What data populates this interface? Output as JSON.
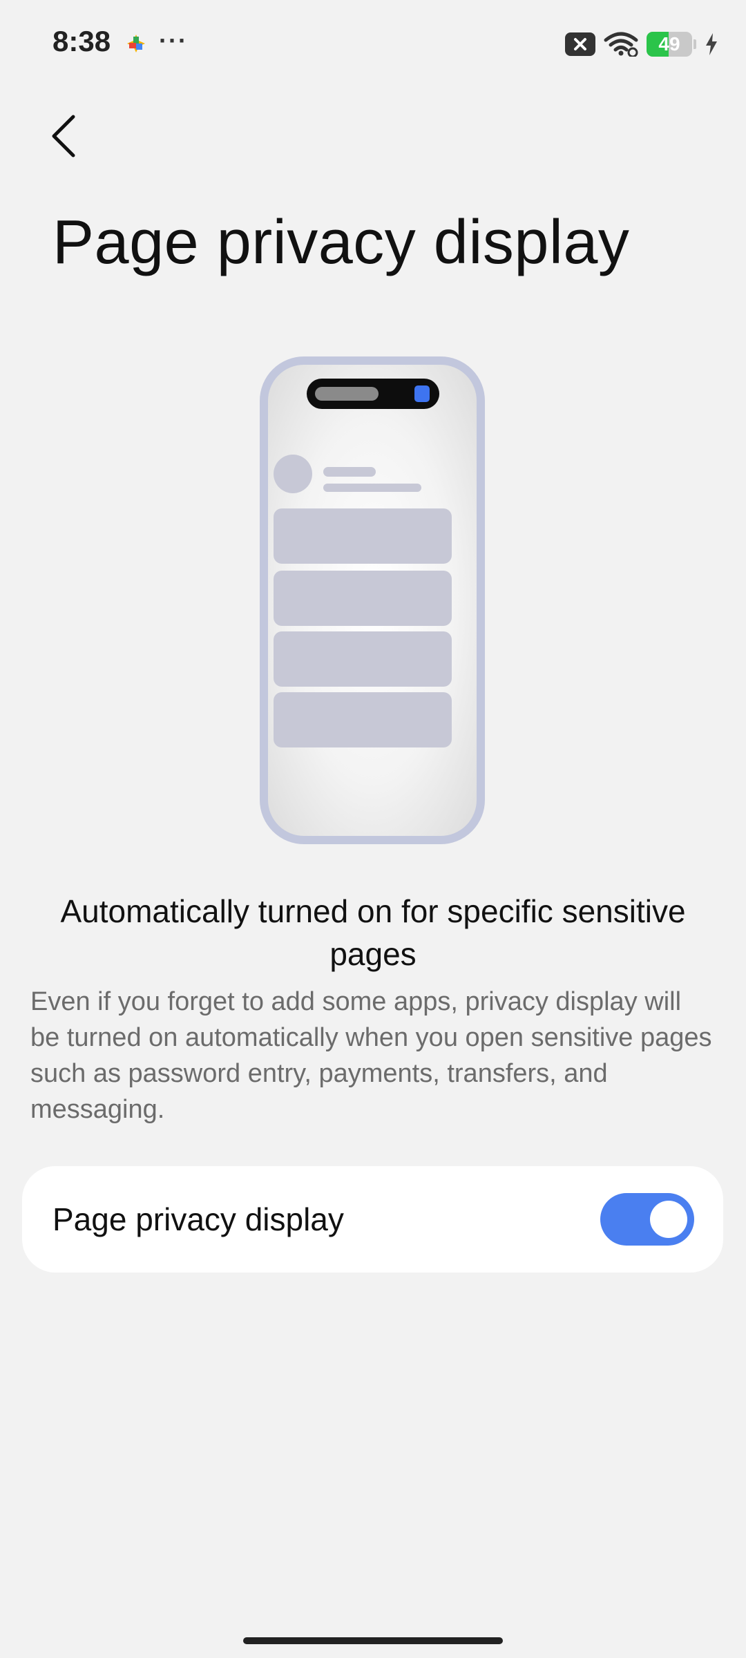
{
  "status_bar": {
    "time": "8:38",
    "app_icon": "colorful-app-icon",
    "more": "···",
    "battery_level": "49",
    "icons": [
      "notification-blocked-icon",
      "wifi-icon",
      "battery-icon",
      "charging-icon"
    ]
  },
  "header": {
    "back_icon": "back-chevron-icon",
    "title": "Page privacy display"
  },
  "illustration": {
    "icon": "phone-illustration",
    "frame_color": "#c2c7dd",
    "accent_color": "#3e74f0"
  },
  "feature": {
    "title": "Automatically turned on for specific sensitive pages",
    "description": "Even if you forget to add some apps, privacy display will be turned on automatically when you open sensitive pages such as password entry, payments, transfers, and messaging."
  },
  "setting": {
    "label": "Page privacy display",
    "enabled": true,
    "switch_color": "#4a7ff0"
  }
}
